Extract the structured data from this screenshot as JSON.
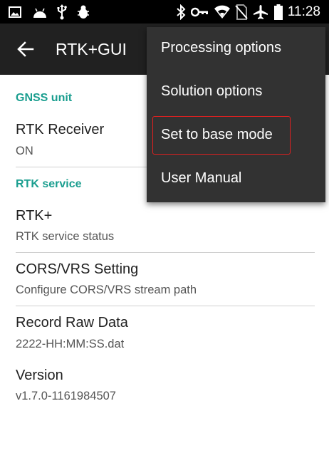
{
  "status_bar": {
    "time": "11:28",
    "left_icons": [
      "image-icon",
      "android-icon",
      "usb-icon",
      "bug-icon"
    ],
    "right_icons": [
      "bluetooth-icon",
      "vpn-key-icon",
      "wifi-icon",
      "no-sim-icon",
      "airplane-icon",
      "battery-icon"
    ]
  },
  "app_bar": {
    "title": "RTK+GUI"
  },
  "sections": {
    "gnss": {
      "header": "GNSS unit",
      "rtk_receiver": {
        "title": "RTK Receiver",
        "summary": "ON"
      }
    },
    "rtk_service": {
      "header": "RTK service",
      "rtk_plus": {
        "title": "RTK+",
        "summary": "RTK service status"
      },
      "cors": {
        "title": "CORS/VRS Setting",
        "summary": "Configure CORS/VRS stream path"
      },
      "raw_data": {
        "title": "Record Raw Data",
        "summary": "2222-HH:MM:SS.dat"
      },
      "version": {
        "title": "Version",
        "summary": "v1.7.0-1161984507"
      }
    }
  },
  "menu": {
    "items": [
      {
        "label": "Processing options"
      },
      {
        "label": "Solution options"
      },
      {
        "label": "Set to base mode"
      },
      {
        "label": "User Manual"
      }
    ]
  },
  "colors": {
    "accent": "#1a9e8f",
    "toolbar": "#212121",
    "menu_bg": "#323232",
    "highlight": "#e02020"
  }
}
